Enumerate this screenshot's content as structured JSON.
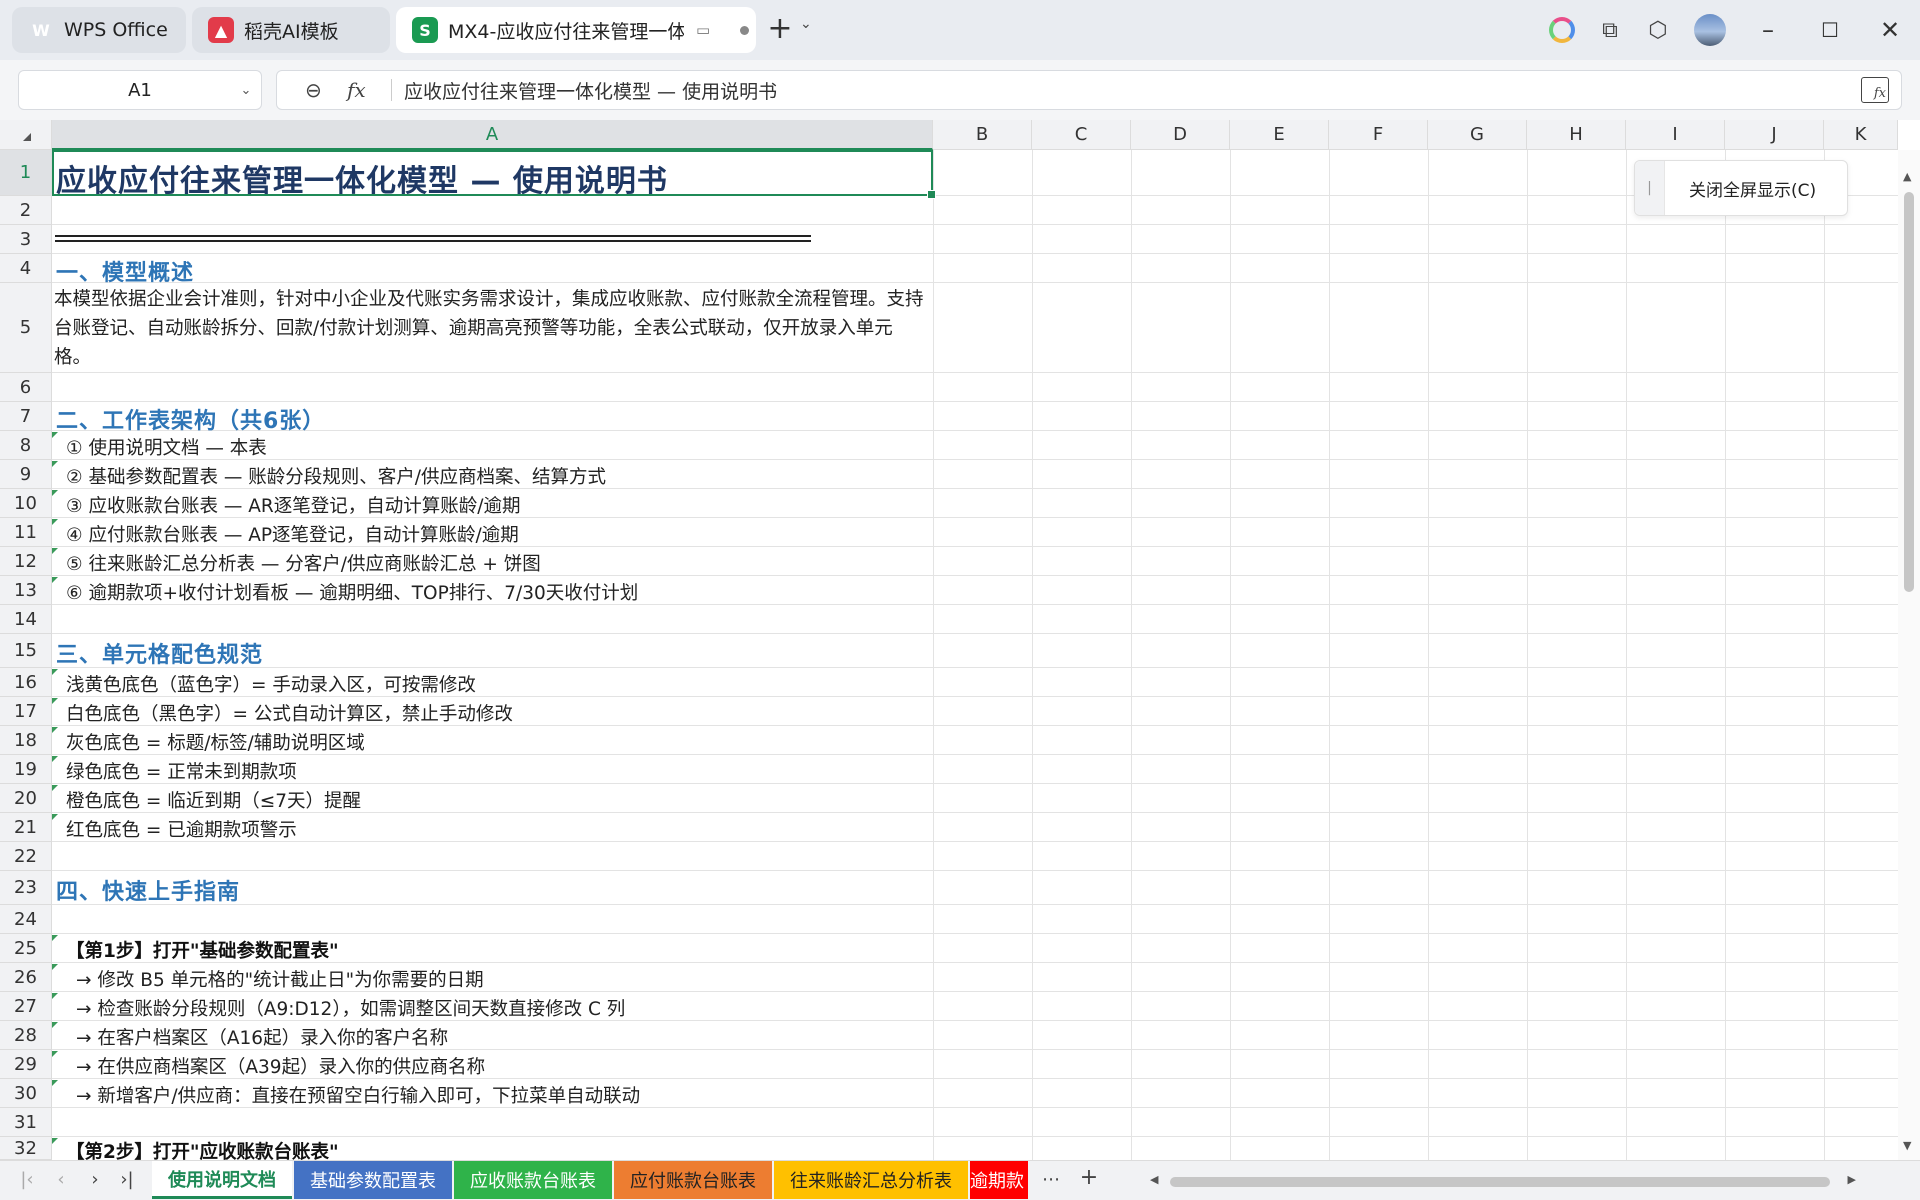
{
  "titlebar": {
    "tabs": [
      {
        "label": "WPS Office",
        "icon": "wps-logo-icon"
      },
      {
        "label": "稻壳AI模板",
        "icon": "daoke-icon"
      },
      {
        "label": "MX4-应收应付往来管理一体",
        "icon": "spreadsheet-icon"
      }
    ]
  },
  "formula_bar": {
    "name_box": "A1",
    "formula": "应收应付往来管理一体化模型 — 使用说明书"
  },
  "columns": [
    "A",
    "B",
    "C",
    "D",
    "E",
    "F",
    "G",
    "H",
    "I",
    "J",
    "K"
  ],
  "rows": [
    "1",
    "2",
    "3",
    "4",
    "5",
    "6",
    "7",
    "8",
    "9",
    "10",
    "11",
    "12",
    "13",
    "14",
    "15",
    "16",
    "17",
    "18",
    "19",
    "20",
    "21",
    "22",
    "23",
    "24",
    "25",
    "26",
    "27",
    "28",
    "29",
    "30",
    "31",
    "32"
  ],
  "cells": {
    "r1": "应收应付往来管理一体化模型 — 使用说明书",
    "r4": "一、模型概述",
    "r5": "本模型依据企业会计准则，针对中小企业及代账实务需求设计，集成应收账款、应付账款全流程管理。支持台账登记、自动账龄拆分、回款/付款计划测算、逾期高亮预警等功能，全表公式联动，仅开放录入单元格。",
    "r7": "二、工作表架构（共6张）",
    "r8": "① 使用说明文档 — 本表",
    "r9": "② 基础参数配置表 — 账龄分段规则、客户/供应商档案、结算方式",
    "r10": "③ 应收账款台账表 — AR逐笔登记，自动计算账龄/逾期",
    "r11": "④ 应付账款台账表 — AP逐笔登记，自动计算账龄/逾期",
    "r12": "⑤ 往来账龄汇总分析表 — 分客户/供应商账龄汇总 + 饼图",
    "r13": "⑥ 逾期款项+收付计划看板 — 逾期明细、TOP排行、7/30天收付计划",
    "r15": "三、单元格配色规范",
    "r16": "浅黄色底色（蓝色字）= 手动录入区，可按需修改",
    "r17": "白色底色（黑色字）= 公式自动计算区，禁止手动修改",
    "r18": "灰色底色 = 标题/标签/辅助说明区域",
    "r19": "绿色底色 = 正常未到期款项",
    "r20": "橙色底色 = 临近到期（≤7天）提醒",
    "r21": "红色底色 = 已逾期款项警示",
    "r23": "四、快速上手指南",
    "r25": "【第1步】打开\"基础参数配置表\"",
    "r26": "→ 修改 B5 单元格的\"统计截止日\"为你需要的日期",
    "r27": "→ 检查账龄分段规则（A9:D12），如需调整区间天数直接修改 C 列",
    "r28": "→ 在客户档案区（A16起）录入你的客户名称",
    "r29": "→ 在供应商档案区（A39起）录入你的供应商名称",
    "r30": "→ 新增客户/供应商：直接在预留空白行输入即可，下拉菜单自动联动",
    "r32": "【第2步】打开\"应收账款台账表\""
  },
  "popup": {
    "label": "关闭全屏显示(C)"
  },
  "sheet_tabs": [
    {
      "label": "使用说明文档",
      "color": "#ffffff",
      "active": true
    },
    {
      "label": "基础参数配置表",
      "color": "#4472c4",
      "active": false
    },
    {
      "label": "应收账款台账表",
      "color": "#2fb34a",
      "active": false
    },
    {
      "label": "应付账款台账表",
      "color": "#ed7d31",
      "active": false
    },
    {
      "label": "往来账龄汇总分析表",
      "color": "#ffc000",
      "active": false
    },
    {
      "label": "逾期款",
      "color": "#ff0000",
      "active": false
    }
  ],
  "colors": {
    "title": "#1f3864",
    "section": "#2e75b6",
    "accent": "#1f8a57"
  }
}
